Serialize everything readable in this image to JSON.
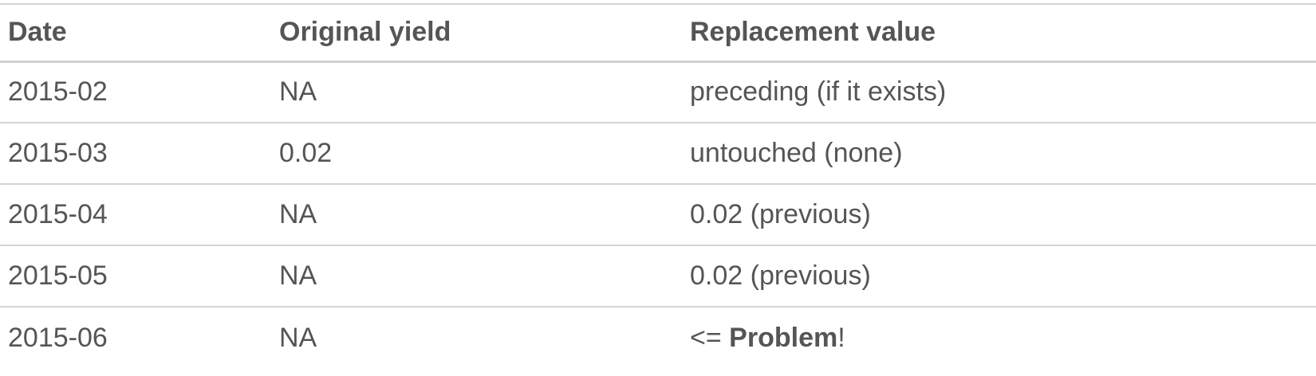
{
  "table": {
    "headers": {
      "date": "Date",
      "original_yield": "Original yield",
      "replacement_value": "Replacement value"
    },
    "rows": [
      {
        "date": "2015-02",
        "original_yield": "NA",
        "replacement_value": "preceding (if it exists)"
      },
      {
        "date": "2015-03",
        "original_yield": "0.02",
        "replacement_value": "untouched (none)"
      },
      {
        "date": "2015-04",
        "original_yield": "NA",
        "replacement_value": "0.02 (previous)"
      },
      {
        "date": "2015-05",
        "original_yield": "NA",
        "replacement_value": "0.02 (previous)"
      },
      {
        "date": "2015-06",
        "original_yield": "NA",
        "replacement_value_prefix": "<= ",
        "replacement_value_bold": "Problem",
        "replacement_value_suffix": "!"
      }
    ]
  }
}
